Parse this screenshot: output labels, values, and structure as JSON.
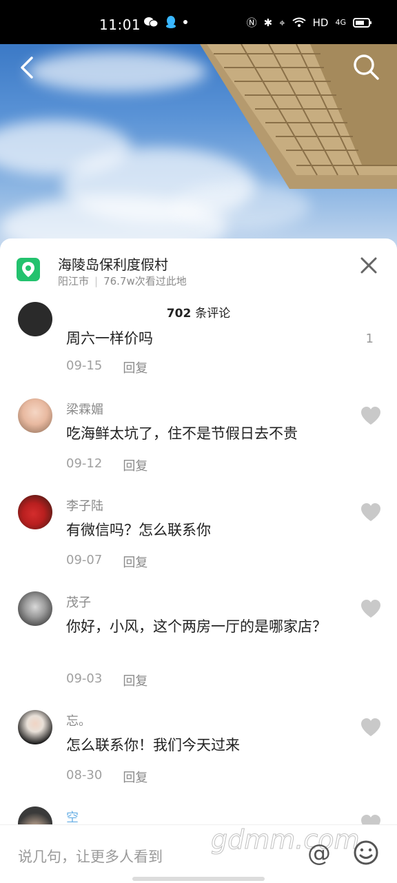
{
  "status": {
    "time": "11:01",
    "network": "HD",
    "signal": "4G"
  },
  "location": {
    "title": "海陵岛保利度假村",
    "city": "阳江市",
    "separator": "|",
    "views": "76.7w次看过此地"
  },
  "comments_header": {
    "count": "702",
    "unit": "条评论"
  },
  "comments": [
    {
      "user": "",
      "text": "周六一样价吗",
      "date": "09-15",
      "reply": "回复",
      "likes": "1"
    },
    {
      "user": "梁霖媚",
      "text": "吃海鲜太坑了，住不是节假日去不贵",
      "date": "09-12",
      "reply": "回复"
    },
    {
      "user": "李子陆",
      "text": "有微信吗？怎么联系你",
      "date": "09-07",
      "reply": "回复"
    },
    {
      "user": "茂子",
      "text": "你好，小风，这个两房一厅的是哪家店？",
      "date": "09-03",
      "reply": "回复"
    },
    {
      "user": "忘。",
      "text": "怎么联系你！我们今天过来",
      "date": "08-30",
      "reply": "回复"
    },
    {
      "user": "空",
      "text": "",
      "date": "",
      "reply": ""
    }
  ],
  "input": {
    "placeholder": "说几句，让更多人看到"
  },
  "watermark": "gdmm.com",
  "colors": {
    "accent_green": "#23c26e",
    "sky_blue": "#3b79c6"
  }
}
